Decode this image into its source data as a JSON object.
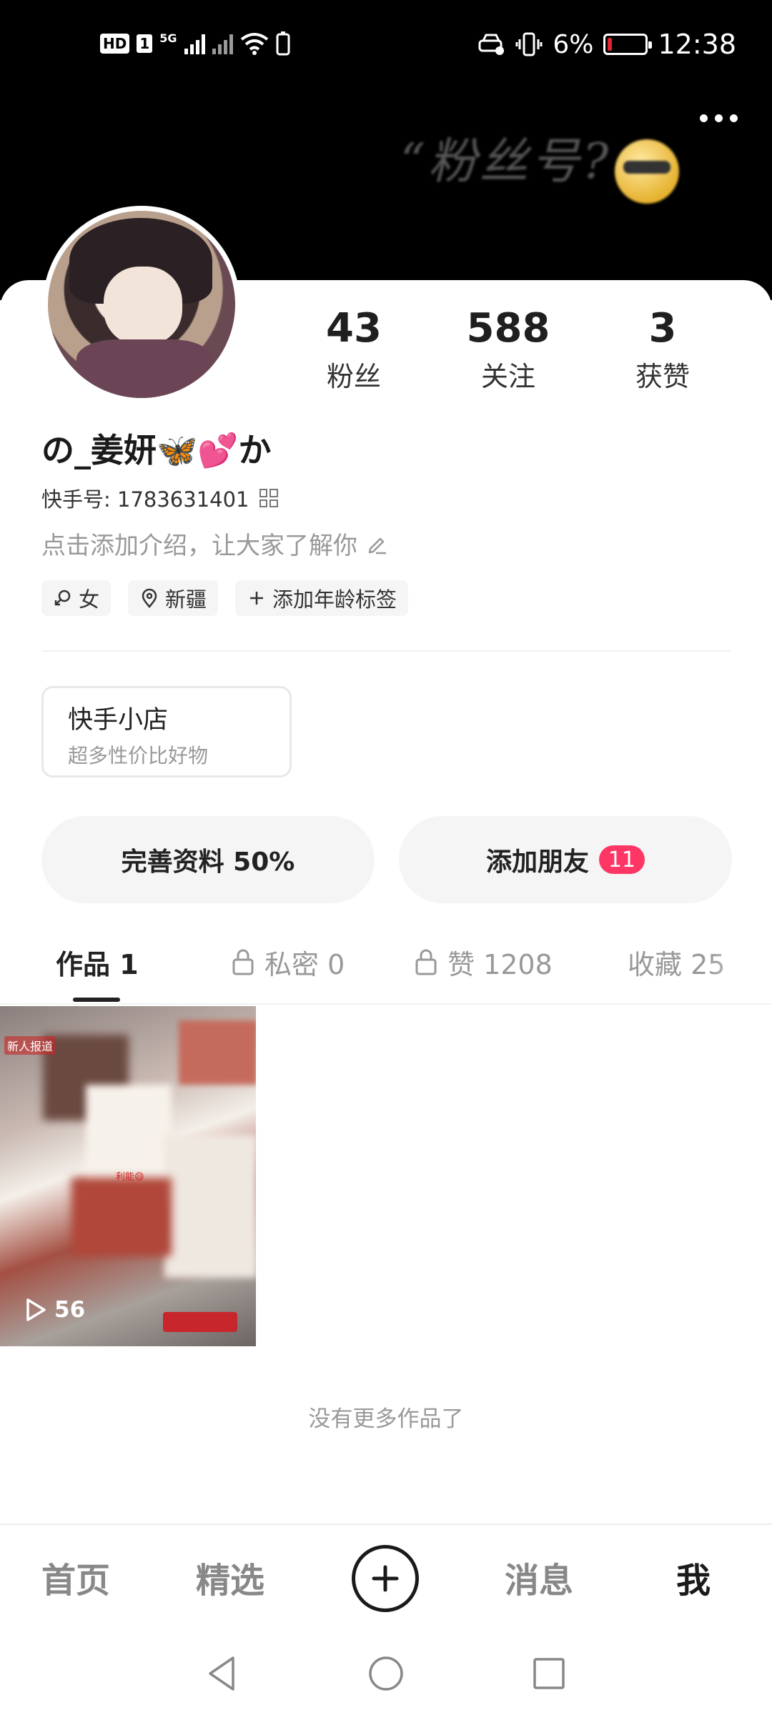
{
  "status_bar": {
    "hd_label": "HD",
    "sim_label": "1",
    "network_label": "5G",
    "battery_percent": "6%",
    "time": "12:38"
  },
  "banner": {
    "art_text": "“粉丝号?",
    "more_icon": "more-dots-icon"
  },
  "profile": {
    "stats": [
      {
        "value": "43",
        "label": "粉丝"
      },
      {
        "value": "588",
        "label": "关注"
      },
      {
        "value": "3",
        "label": "获赞"
      }
    ],
    "name": "の_姜妍🦋💕か",
    "kuaishou_id": "快手号: 1783631401",
    "intro": "点击添加介绍，让大家了解你",
    "tags": [
      {
        "icon": "gender-female-icon",
        "label": "女"
      },
      {
        "icon": "location-pin-icon",
        "label": "新疆"
      },
      {
        "icon": "plus-icon",
        "label": "添加年龄标签"
      }
    ]
  },
  "shop": {
    "title": "快手小店",
    "subtitle": "超多性价比好物"
  },
  "actions": {
    "complete_profile": "完善资料 50%",
    "add_friends": "添加朋友",
    "add_friends_badge": "11"
  },
  "tabs": [
    {
      "label": "作品 1",
      "locked": false
    },
    {
      "label": "私密 0",
      "locked": true
    },
    {
      "label": "赞 1208",
      "locked": true
    },
    {
      "label": "收藏 25",
      "locked": false
    }
  ],
  "video": {
    "corner_label": "新人报道",
    "mid_label": "利能😄",
    "play_count": "56"
  },
  "no_more_text": "没有更多作品了",
  "bottom_nav": {
    "home": "首页",
    "featured": "精选",
    "messages": "消息",
    "me": "我"
  },
  "colors": {
    "accent_badge": "#fe3666",
    "battery_low": "#e0242f"
  }
}
